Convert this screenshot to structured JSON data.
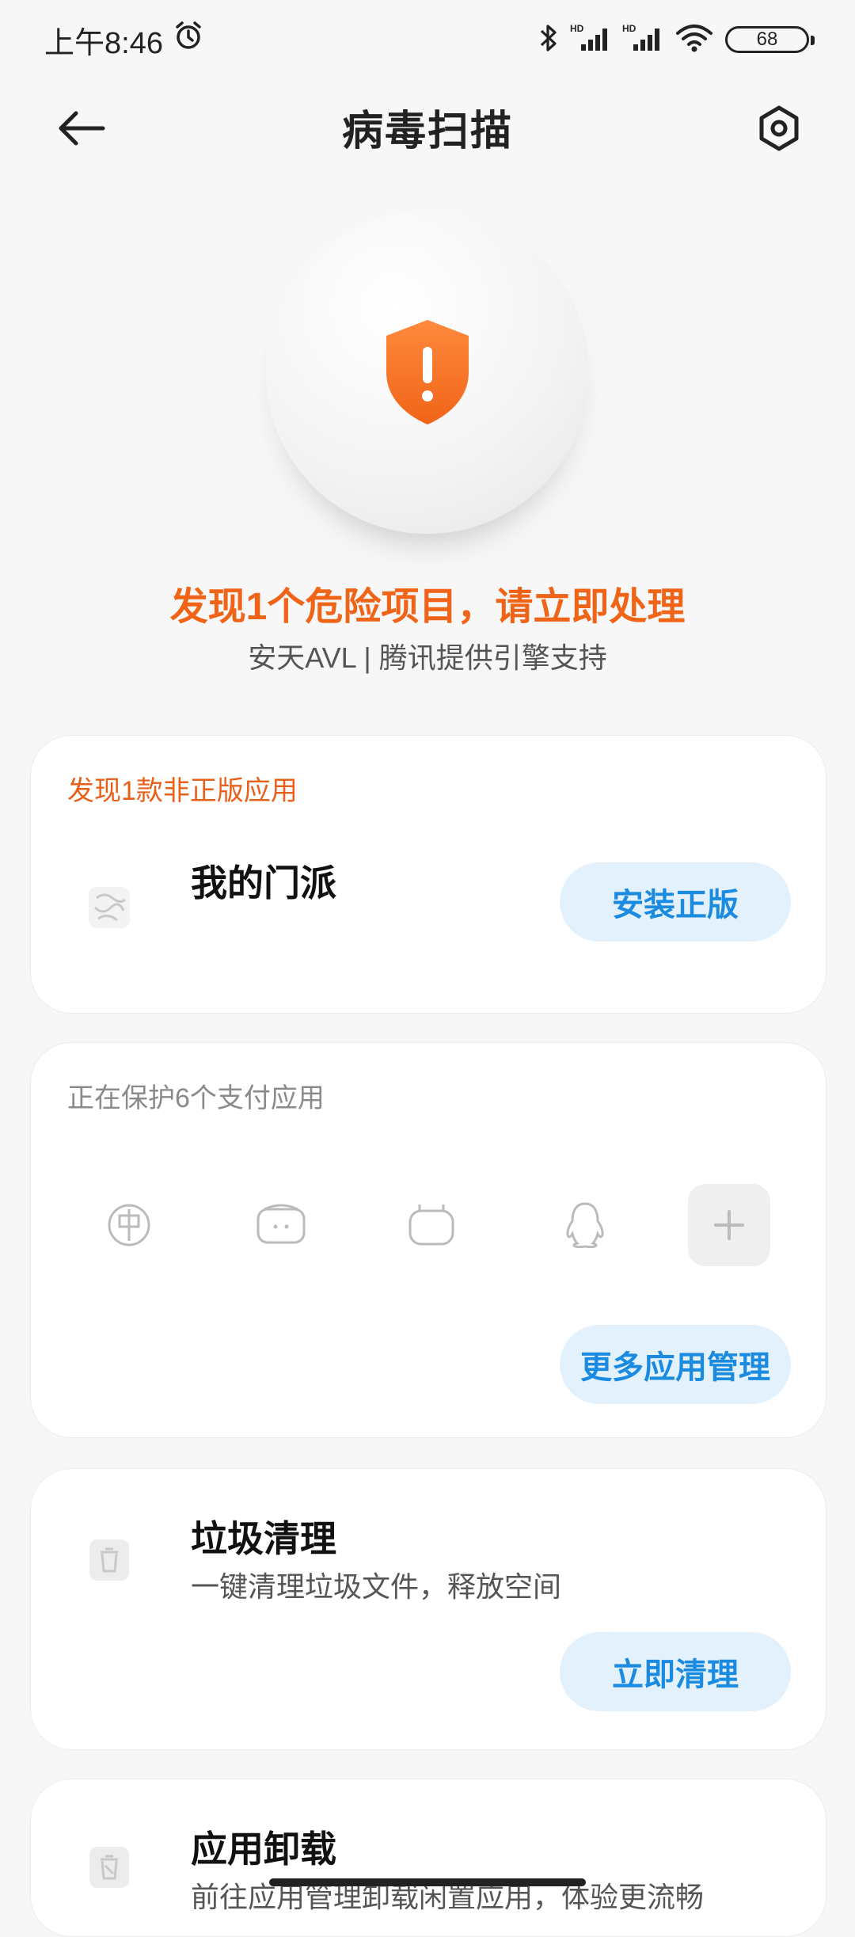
{
  "status_bar": {
    "time": "上午8:46",
    "battery": "68",
    "network_label_1": "HD",
    "network_label_2": "HD"
  },
  "header": {
    "title": "病毒扫描"
  },
  "scan_result": {
    "alert_title": "发现1个危险项目，请立即处理",
    "engine_credit": "安天AVL | 腾讯提供引擎支持"
  },
  "pirated_card": {
    "header": "发现1款非正版应用",
    "app_name": "我的门派",
    "button_label": "安装正版"
  },
  "payment_card": {
    "header": "正在保护6个支付应用",
    "apps": [
      "bank-app-icon",
      "wallet-app-icon",
      "pay-app-icon",
      "qq-icon"
    ],
    "button_label": "更多应用管理"
  },
  "cleanup_card": {
    "title": "垃圾清理",
    "description": "一键清理垃圾文件，释放空间",
    "button_label": "立即清理"
  },
  "uninstall_card": {
    "title": "应用卸载",
    "description": "前往应用管理卸载闲置应用，体验更流畅"
  },
  "colors": {
    "alert": "#f06418",
    "accent": "#1a8be0",
    "pill_bg": "#e3f1fd"
  }
}
